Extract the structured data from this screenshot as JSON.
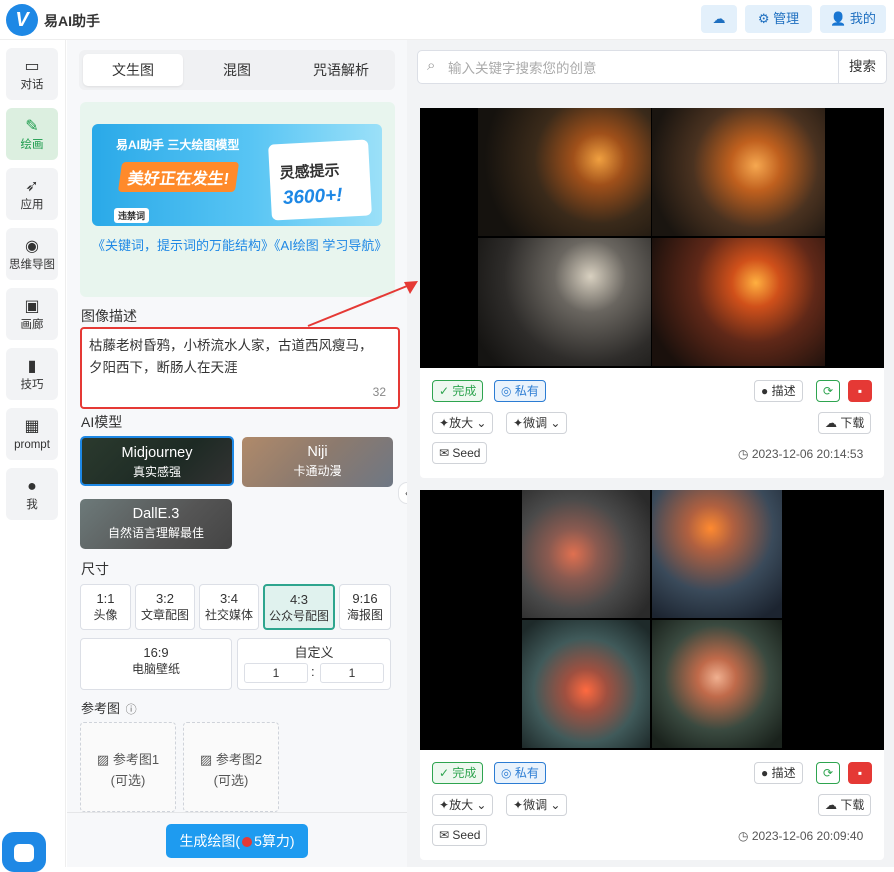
{
  "app": {
    "name": "易AI助手",
    "logo_letter": "V"
  },
  "header": {
    "weather_icon": "weather-icon",
    "manage_label": "管理",
    "profile_label": "我的"
  },
  "sidebar": {
    "items": [
      {
        "label": "对话",
        "icon": "chat-icon"
      },
      {
        "label": "绘画",
        "icon": "brush-icon",
        "active": true
      },
      {
        "label": "应用",
        "icon": "rocket-icon"
      },
      {
        "label": "思维导图",
        "icon": "mindmap-icon"
      },
      {
        "label": "画廊",
        "icon": "gallery-icon"
      },
      {
        "label": "技巧",
        "icon": "book-icon"
      },
      {
        "label": "prompt",
        "icon": "gift-icon"
      },
      {
        "label": "我",
        "icon": "user-icon"
      }
    ]
  },
  "left": {
    "tabs": [
      "文生图",
      "混图",
      "咒语解析"
    ],
    "active_tab": "文生图",
    "promo": {
      "banner_line1": "易AI助手 三大绘图模型",
      "banner_line2": "美好正在发生!",
      "banner_card_title": "灵感提示",
      "banner_card_count": "3600+!",
      "banner_tag": "违禁词",
      "link_text": "《关键词，提示词的万能结构》《AI绘图 学习导航》"
    },
    "desc_label": "图像描述",
    "desc_value": "枯藤老树昏鸦，小桥流水人家，古道西风瘦马，夕阳西下，断肠人在天涯",
    "desc_count": "32",
    "model_label": "AI模型",
    "models": [
      {
        "name": "Midjourney",
        "sub": "真实感强",
        "selected": true
      },
      {
        "name": "Niji",
        "sub": "卡通动漫",
        "selected": false
      },
      {
        "name": "DallE.3",
        "sub": "自然语言理解最佳",
        "selected": false
      }
    ],
    "size_label": "尺寸",
    "sizes": [
      {
        "ratio": "1:1",
        "name": "头像"
      },
      {
        "ratio": "3:2",
        "name": "文章配图"
      },
      {
        "ratio": "3:4",
        "name": "社交媒体"
      },
      {
        "ratio": "4:3",
        "name": "公众号配图",
        "active": true
      },
      {
        "ratio": "9:16",
        "name": "海报图"
      },
      {
        "ratio": "16:9",
        "name": "电脑壁纸"
      }
    ],
    "custom": {
      "label": "自定义",
      "w": "1",
      "h": "1",
      "sep": ":"
    },
    "ref_label": "参考图",
    "refs": [
      {
        "label": "参考图1",
        "opt": "(可选)"
      },
      {
        "label": "参考图2",
        "opt": "(可选)"
      }
    ],
    "generate": {
      "label": "生成绘图(",
      "cost": "5算力)"
    }
  },
  "right": {
    "search_placeholder": "输入关键字搜索您的创意",
    "search_button": "搜索",
    "cards": [
      {
        "status": "完成",
        "privacy": "私有",
        "describe": "描述",
        "upscale": "放大",
        "vary": "微调",
        "download": "下载",
        "seed": "Seed",
        "time": "2023-12-06 20:14:53"
      },
      {
        "status": "完成",
        "privacy": "私有",
        "describe": "描述",
        "upscale": "放大",
        "vary": "微调",
        "download": "下载",
        "seed": "Seed",
        "time": "2023-12-06 20:09:40"
      }
    ]
  },
  "colors": {
    "accent": "#1e88e5",
    "danger": "#e53935",
    "success": "#2ea44f"
  }
}
